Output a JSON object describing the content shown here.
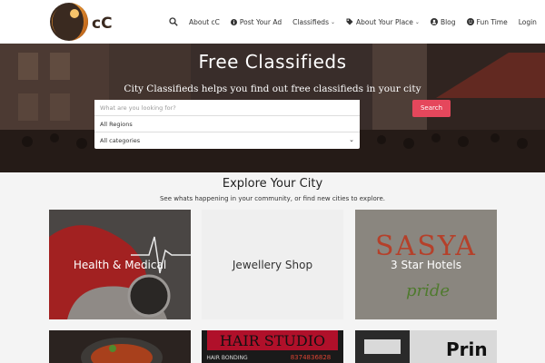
{
  "brand": {
    "logo_text": "cC"
  },
  "nav": {
    "about": "About cC",
    "post_ad": "Post Your Ad",
    "classifieds": "Classifieds",
    "about_place": "About Your Place",
    "blog": "Blog",
    "fun_time": "Fun Time",
    "login": "Login"
  },
  "hero": {
    "title": "Free Classifieds",
    "subtitle": "City Classifieds helps you find out free classifieds in your city",
    "search_placeholder": "What are you looking for?",
    "region_value": "All Regions",
    "category_value": "All categories",
    "search_button": "Search"
  },
  "explore": {
    "title": "Explore Your City",
    "subtitle": "See whats happening in your community, or find new cities to explore."
  },
  "cards": [
    {
      "label": "Health & Medical"
    },
    {
      "label": "Jewellery Shop"
    },
    {
      "label": "3 Star Hotels",
      "image_text": "SASYA",
      "image_script": "pride"
    },
    {
      "label": ""
    },
    {
      "label": "",
      "image_text": "HAIR STUDIO",
      "image_subtext": "HAIR BONDING",
      "image_phone": "8374836828"
    },
    {
      "label": "",
      "image_text": "Prin"
    }
  ],
  "colors": {
    "accent": "#e5475c",
    "logo_orange": "#e0892a",
    "logo_dark": "#3a2a20"
  },
  "icons": [
    "search-icon",
    "info-icon",
    "tag-icon",
    "user-icon",
    "comment-icon",
    "smile-icon",
    "chevron-down-icon"
  ]
}
